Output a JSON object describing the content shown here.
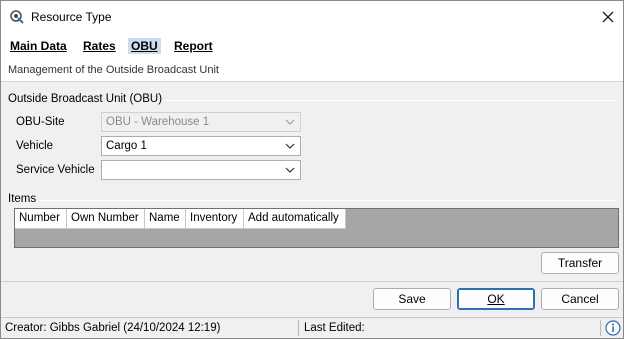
{
  "window": {
    "title": "Resource Type"
  },
  "tabs": [
    {
      "label": "Main Data",
      "active": false
    },
    {
      "label": "Rates",
      "active": false
    },
    {
      "label": "OBU",
      "active": true
    },
    {
      "label": "Report",
      "active": false
    }
  ],
  "subtitle": "Management of the Outside Broadcast Unit",
  "obu_group": {
    "title": "Outside Broadcast Unit (OBU)",
    "fields": {
      "site": {
        "label": "OBU-Site",
        "value": "OBU - Warehouse 1",
        "disabled": true
      },
      "vehicle": {
        "label": "Vehicle",
        "value": "Cargo 1"
      },
      "service_vehicle": {
        "label": "Service Vehicle",
        "value": ""
      }
    }
  },
  "items_group": {
    "title": "Items",
    "columns": [
      "Number",
      "Own Number",
      "Name",
      "Inventory",
      "Add automatically"
    ],
    "transfer_label": "Transfer"
  },
  "footer": {
    "save_label": "Save",
    "ok_label": "OK",
    "cancel_label": "Cancel"
  },
  "status": {
    "creator": "Creator: Gibbs Gabriel (24/10/2024 12:19)",
    "last_edited": "Last Edited:"
  },
  "colors": {
    "active_tab_bg": "#cfdcf0",
    "primary_border": "#2f6fb8",
    "grid_bg": "#a6a6a6"
  }
}
